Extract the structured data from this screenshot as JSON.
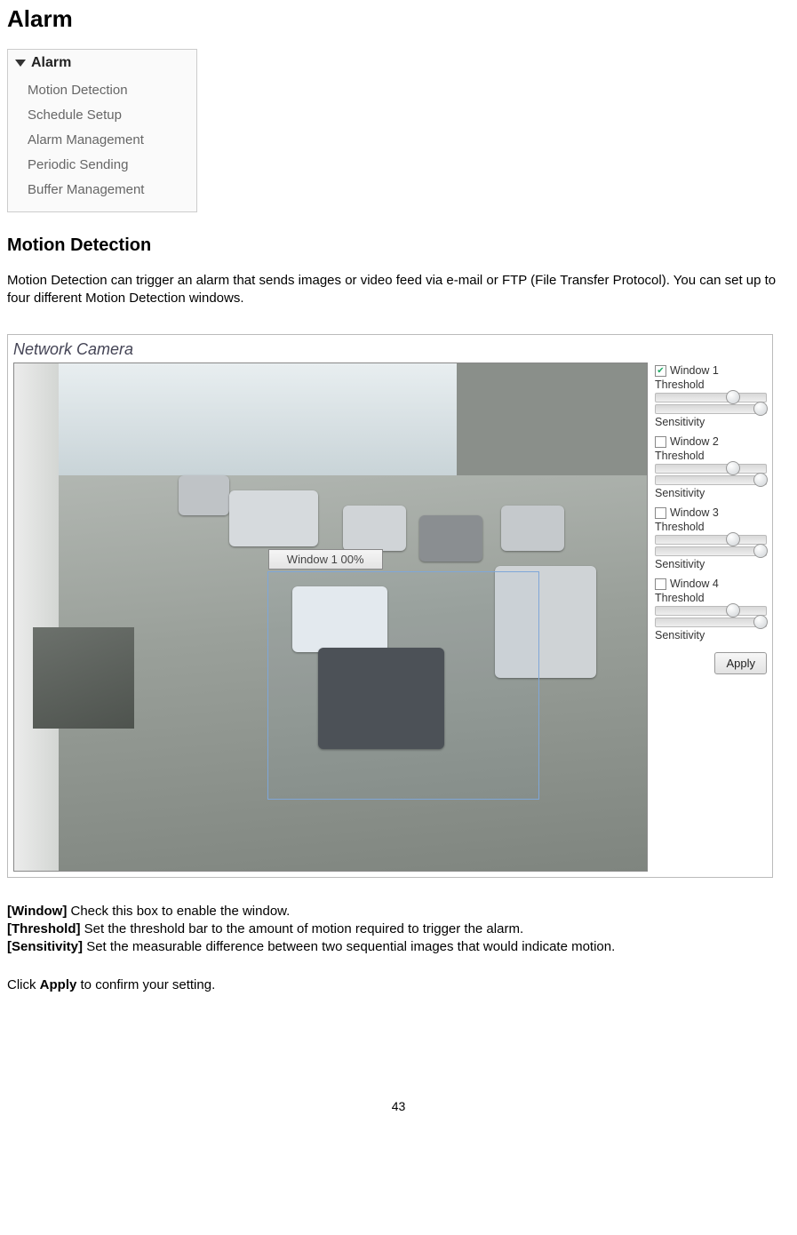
{
  "headings": {
    "h1": "Alarm",
    "h2": "Motion Detection"
  },
  "menu": {
    "title": "Alarm",
    "items": [
      "Motion Detection",
      "Schedule Setup",
      "Alarm Management",
      "Periodic Sending",
      "Buffer Management"
    ]
  },
  "intro": "Motion Detection can trigger an alarm that sends images or video feed via e-mail or FTP (File Transfer Protocol). You can set up to four different Motion Detection windows.",
  "screenshot": {
    "title": "Network Camera",
    "selection_label": "Window 1 00%",
    "windows": [
      {
        "label": "Window 1",
        "checked": true,
        "threshold_label": "Threshold",
        "sensitivity_label": "Sensitivity",
        "threshold": 70,
        "sensitivity": 95
      },
      {
        "label": "Window 2",
        "checked": false,
        "threshold_label": "Threshold",
        "sensitivity_label": "Sensitivity",
        "threshold": 70,
        "sensitivity": 95
      },
      {
        "label": "Window 3",
        "checked": false,
        "threshold_label": "Threshold",
        "sensitivity_label": "Sensitivity",
        "threshold": 70,
        "sensitivity": 95
      },
      {
        "label": "Window 4",
        "checked": false,
        "threshold_label": "Threshold",
        "sensitivity_label": "Sensitivity",
        "threshold": 70,
        "sensitivity": 95
      }
    ],
    "apply_label": "Apply"
  },
  "definitions": {
    "window": {
      "key": "[Window]",
      "text": " Check this box to enable the window."
    },
    "threshold": {
      "key": "[Threshold]",
      "text": " Set the threshold bar to the amount of motion required to trigger the alarm."
    },
    "sensitivity": {
      "key": "[Sensitivity]",
      "text": " Set the measurable difference between two sequential images that would indicate motion."
    }
  },
  "closing": {
    "pre": "Click ",
    "bold": "Apply",
    "post": " to confirm your setting."
  },
  "page_number": "43"
}
